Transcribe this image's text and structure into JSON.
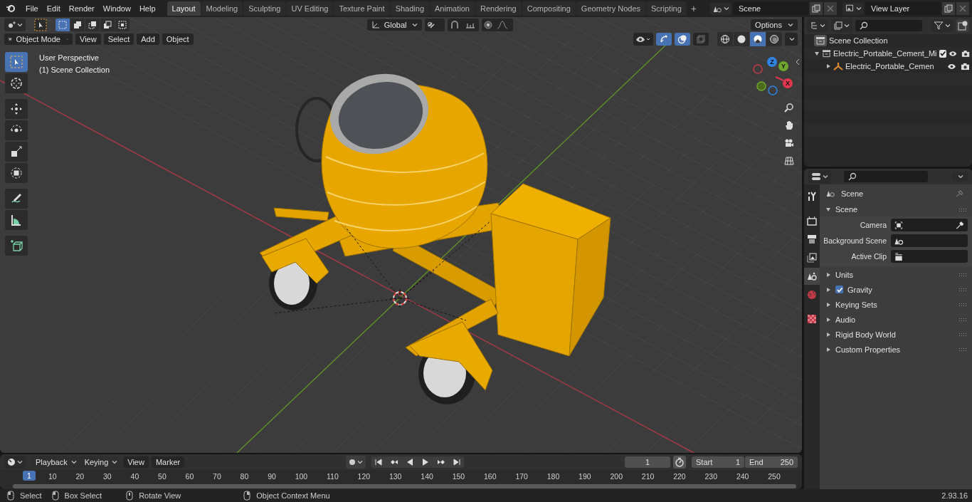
{
  "top_bar": {
    "menus": [
      "File",
      "Edit",
      "Render",
      "Window",
      "Help"
    ],
    "workspaces": [
      {
        "label": "Layout",
        "selected": true
      },
      {
        "label": "Modeling",
        "selected": false
      },
      {
        "label": "Sculpting",
        "selected": false
      },
      {
        "label": "UV Editing",
        "selected": false
      },
      {
        "label": "Texture Paint",
        "selected": false
      },
      {
        "label": "Shading",
        "selected": false
      },
      {
        "label": "Animation",
        "selected": false
      },
      {
        "label": "Rendering",
        "selected": false
      },
      {
        "label": "Compositing",
        "selected": false
      },
      {
        "label": "Geometry Nodes",
        "selected": false
      },
      {
        "label": "Scripting",
        "selected": false
      }
    ],
    "add_workspace": "+",
    "scene": "Scene",
    "view_layer": "View Layer"
  },
  "viewport": {
    "select_modes": [
      {
        "kind": "new",
        "selected": true
      },
      {
        "kind": "extend",
        "selected": false
      },
      {
        "kind": "subtract",
        "selected": false
      },
      {
        "kind": "invert",
        "selected": false
      },
      {
        "kind": "intersect",
        "selected": false
      }
    ],
    "transform_orientation": "Global",
    "options": "Options",
    "mode": "Object Mode",
    "menus": [
      "View",
      "Select",
      "Add",
      "Object"
    ],
    "gizmos_on": true,
    "overlays_on": true,
    "xray_on": false,
    "shading": [
      {
        "kind": "wireframe",
        "selected": false
      },
      {
        "kind": "solid",
        "selected": false
      },
      {
        "kind": "material",
        "selected": true
      },
      {
        "kind": "rendered",
        "selected": false
      }
    ],
    "overlay_text": [
      "User Perspective",
      "(1) Scene Collection"
    ],
    "tools": [
      {
        "kind": "select",
        "selected": true
      },
      {
        "kind": "cursor",
        "selected": false
      },
      {
        "kind": "move",
        "selected": false
      },
      {
        "kind": "rotate",
        "selected": false
      },
      {
        "kind": "scale",
        "selected": false
      },
      {
        "kind": "transform",
        "selected": false
      },
      {
        "kind": "annotate",
        "selected": false
      },
      {
        "kind": "measure",
        "selected": false
      },
      {
        "kind": "add-cube",
        "selected": false
      }
    ],
    "gizmo_axes": [
      "Z",
      "Y",
      "X"
    ]
  },
  "outliner": {
    "root": "Scene Collection",
    "items": [
      {
        "label": "Electric_Portable_Cement_Mi",
        "expanded": true,
        "checked": true,
        "children": [
          {
            "label": "Electric_Portable_Cemen",
            "expanded": false
          }
        ]
      }
    ]
  },
  "properties": {
    "tabs": [
      {
        "kind": "tool",
        "selected": false
      },
      {
        "kind": "render",
        "selected": false
      },
      {
        "kind": "output",
        "selected": false
      },
      {
        "kind": "view-layer",
        "selected": false
      },
      {
        "kind": "scene",
        "selected": true
      },
      {
        "kind": "world",
        "selected": false
      },
      {
        "kind": "texture",
        "selected": false
      }
    ],
    "context": "Scene",
    "panel": {
      "title": "Scene",
      "expanded": true,
      "fields": [
        {
          "kind": "camera",
          "label": "Camera"
        },
        {
          "kind": "scene",
          "label": "Background Scene"
        },
        {
          "kind": "clip",
          "label": "Active Clip"
        }
      ]
    },
    "subpanels": [
      {
        "kind": "plain",
        "label": "Units"
      },
      {
        "kind": "checkbox",
        "label": "Gravity",
        "checked": true
      },
      {
        "kind": "plain",
        "label": "Keying Sets"
      },
      {
        "kind": "plain",
        "label": "Audio"
      },
      {
        "kind": "plain",
        "label": "Rigid Body World"
      },
      {
        "kind": "plain",
        "label": "Custom Properties"
      }
    ]
  },
  "timeline": {
    "dropdowns": [
      "Playback",
      "Keying"
    ],
    "menus": [
      "View",
      "Marker"
    ],
    "current_frame": "1",
    "start_label": "Start",
    "start": "1",
    "end_label": "End",
    "end": "250",
    "playhead": "1",
    "ticks": [
      "10",
      "20",
      "30",
      "40",
      "50",
      "60",
      "70",
      "80",
      "90",
      "100",
      "110",
      "120",
      "130",
      "140",
      "150",
      "160",
      "170",
      "180",
      "190",
      "200",
      "210",
      "220",
      "230",
      "240",
      "250"
    ]
  },
  "status_bar": {
    "hints": [
      {
        "kind": "left",
        "label": "Select"
      },
      {
        "kind": "drag",
        "label": "Box Select"
      },
      {
        "kind": "middle",
        "label": "Rotate View"
      },
      {
        "kind": "right",
        "label": "Object Context Menu"
      }
    ],
    "version": "2.93.16"
  }
}
